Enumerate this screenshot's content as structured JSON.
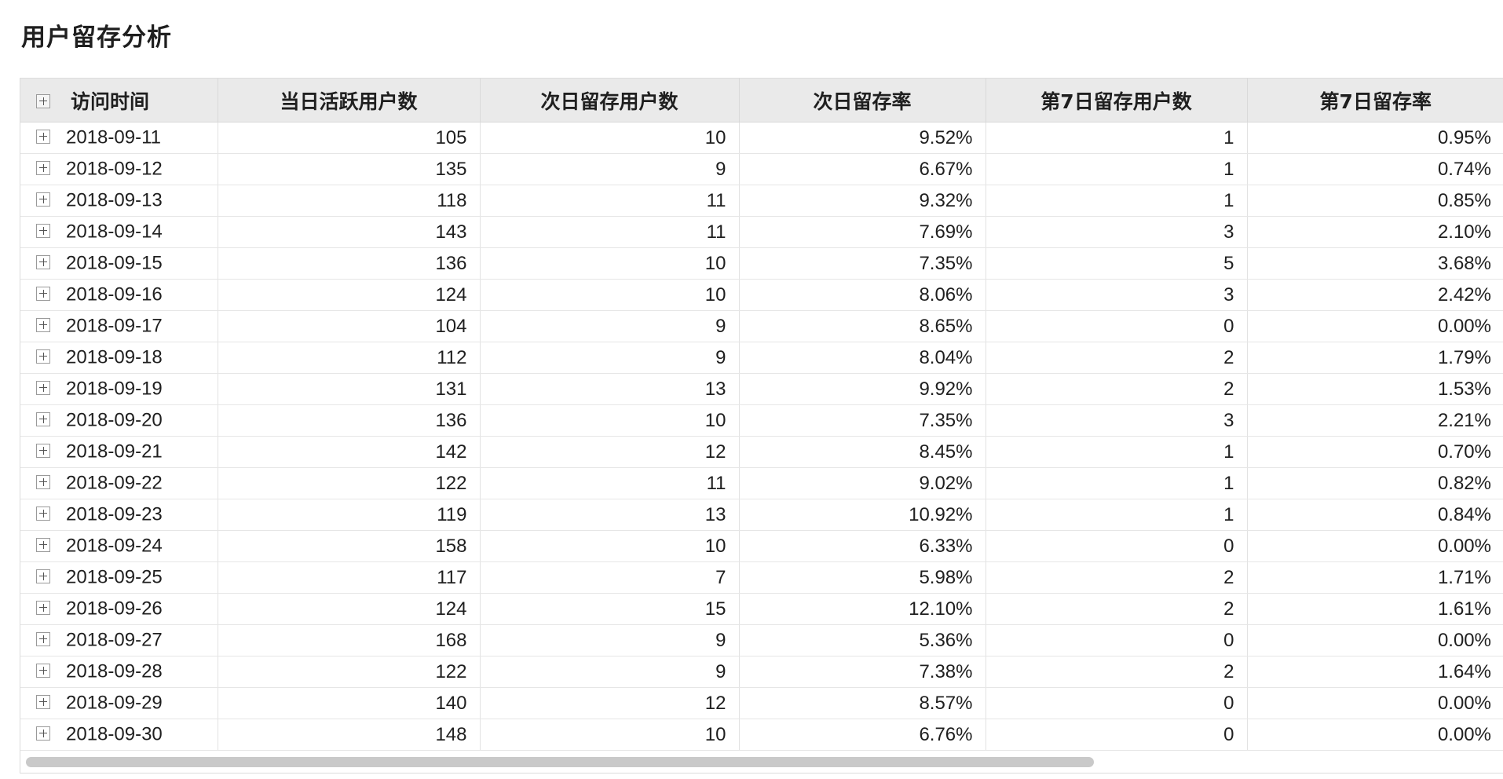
{
  "page": {
    "title": "用户留存分析"
  },
  "table": {
    "columns": [
      "访问时间",
      "当日活跃用户数",
      "次日留存用户数",
      "次日留存率",
      "第7日留存用户数",
      "第7日留存率"
    ],
    "rows": [
      [
        "2018-09-11",
        "105",
        "10",
        "9.52%",
        "1",
        "0.95%"
      ],
      [
        "2018-09-12",
        "135",
        "9",
        "6.67%",
        "1",
        "0.74%"
      ],
      [
        "2018-09-13",
        "118",
        "11",
        "9.32%",
        "1",
        "0.85%"
      ],
      [
        "2018-09-14",
        "143",
        "11",
        "7.69%",
        "3",
        "2.10%"
      ],
      [
        "2018-09-15",
        "136",
        "10",
        "7.35%",
        "5",
        "3.68%"
      ],
      [
        "2018-09-16",
        "124",
        "10",
        "8.06%",
        "3",
        "2.42%"
      ],
      [
        "2018-09-17",
        "104",
        "9",
        "8.65%",
        "0",
        "0.00%"
      ],
      [
        "2018-09-18",
        "112",
        "9",
        "8.04%",
        "2",
        "1.79%"
      ],
      [
        "2018-09-19",
        "131",
        "13",
        "9.92%",
        "2",
        "1.53%"
      ],
      [
        "2018-09-20",
        "136",
        "10",
        "7.35%",
        "3",
        "2.21%"
      ],
      [
        "2018-09-21",
        "142",
        "12",
        "8.45%",
        "1",
        "0.70%"
      ],
      [
        "2018-09-22",
        "122",
        "11",
        "9.02%",
        "1",
        "0.82%"
      ],
      [
        "2018-09-23",
        "119",
        "13",
        "10.92%",
        "1",
        "0.84%"
      ],
      [
        "2018-09-24",
        "158",
        "10",
        "6.33%",
        "0",
        "0.00%"
      ],
      [
        "2018-09-25",
        "117",
        "7",
        "5.98%",
        "2",
        "1.71%"
      ],
      [
        "2018-09-26",
        "124",
        "15",
        "12.10%",
        "2",
        "1.61%"
      ],
      [
        "2018-09-27",
        "168",
        "9",
        "5.36%",
        "0",
        "0.00%"
      ],
      [
        "2018-09-28",
        "122",
        "9",
        "7.38%",
        "2",
        "1.64%"
      ],
      [
        "2018-09-29",
        "140",
        "12",
        "8.57%",
        "0",
        "0.00%"
      ],
      [
        "2018-09-30",
        "148",
        "10",
        "6.76%",
        "0",
        "0.00%"
      ]
    ]
  },
  "icons": {
    "row_expand": "plus-square-icon",
    "header_expand": "plus-square-icon"
  }
}
